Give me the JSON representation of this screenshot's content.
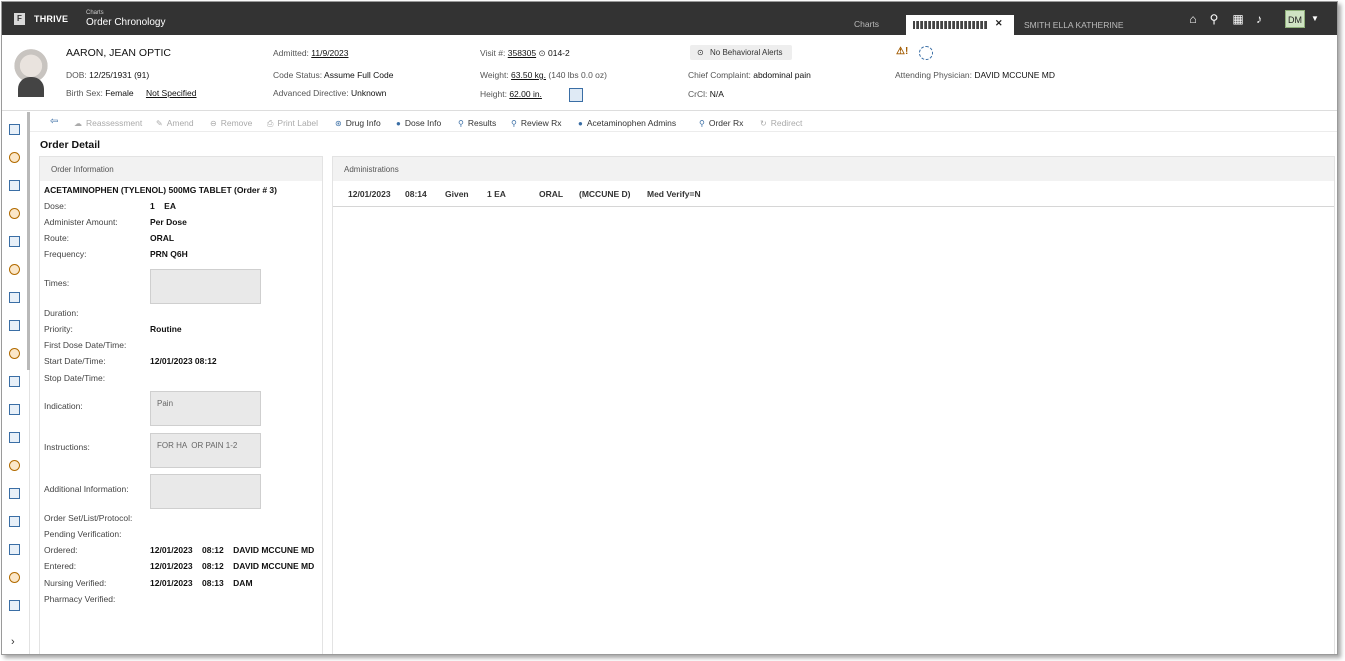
{
  "app": {
    "name": "THRIVE",
    "logo_letter": "F",
    "breadcrumb_parent": "Charts",
    "page_title": "Order Chronology"
  },
  "topnav": {
    "charts_label": "Charts",
    "active_tab_close": "✕",
    "patient_tab": "SMITH ELLA KATHERINE",
    "icons": [
      "home-icon",
      "search-icon",
      "apps-grid-icon",
      "bell-icon"
    ],
    "user_initials": "DM"
  },
  "patient": {
    "name": "AARON, JEAN OPTIC",
    "dob_label": "DOB:",
    "dob": "12/25/1931",
    "age": "(91)",
    "birth_sex_label": "Birth Sex:",
    "birth_sex": "Female",
    "gender": "Not Specified",
    "admitted_label": "Admitted:",
    "admitted": "11/9/2023",
    "code_status_label": "Code Status:",
    "code_status": "Assume Full Code",
    "adv_directive_label": "Advanced Directive:",
    "adv_directive": "Unknown",
    "visit_label": "Visit #:",
    "visit": "358305",
    "room": "014-2",
    "weight_label": "Weight:",
    "weight": "63.50 kg.",
    "weight_alt": "(140 lbs 0.0 oz)",
    "height_label": "Height:",
    "height": "62.00 in.",
    "behavioral_alerts": "No Behavioral Alerts",
    "chief_complaint_label": "Chief Complaint:",
    "chief_complaint": "abdominal pain",
    "crcl_label": "CrCl:",
    "crcl": "N/A",
    "attending_label": "Attending Physician:",
    "attending": "DAVID MCCUNE MD"
  },
  "toolbar": {
    "items": [
      {
        "label": "Reassessment",
        "icon": "reassessment-icon",
        "enabled": false
      },
      {
        "label": "Amend",
        "icon": "pencil-icon",
        "enabled": false
      },
      {
        "label": "Remove",
        "icon": "remove-icon",
        "enabled": false
      },
      {
        "label": "Print Label",
        "icon": "printer-icon",
        "enabled": false
      },
      {
        "label": "Drug Info",
        "icon": "drug-info-icon",
        "enabled": true
      },
      {
        "label": "Dose Info",
        "icon": "info-icon",
        "enabled": true
      },
      {
        "label": "Results",
        "icon": "magnifier-icon",
        "enabled": true
      },
      {
        "label": "Review Rx",
        "icon": "magnifier-icon",
        "enabled": true
      },
      {
        "label": "Acetaminophen Admins",
        "icon": "pill-icon",
        "enabled": true
      },
      {
        "label": "Order Rx",
        "icon": "magnifier-icon",
        "enabled": true
      },
      {
        "label": "Redirect",
        "icon": "redirect-icon",
        "enabled": false
      }
    ]
  },
  "section_title": "Order Detail",
  "order_info": {
    "header": "Order Information",
    "order_name": "ACETAMINOPHEN (TYLENOL) 500MG TABLET (Order # 3)",
    "dose_label": "Dose:",
    "dose": "1    EA",
    "admin_amount_label": "Administer Amount:",
    "admin_amount": "Per Dose",
    "route_label": "Route:",
    "route": "ORAL",
    "frequency_label": "Frequency:",
    "frequency": "PRN Q6H",
    "times_label": "Times:",
    "times": "",
    "duration_label": "Duration:",
    "priority_label": "Priority:",
    "priority": "Routine",
    "first_dose_label": "First Dose Date/Time:",
    "start_label": "Start Date/Time:",
    "start": "12/01/2023 08:12",
    "stop_label": "Stop Date/Time:",
    "indication_label": "Indication:",
    "indication": "Pain",
    "instructions_label": "Instructions:",
    "instructions": "FOR HA  OR PAIN 1-2",
    "additional_label": "Additional Information:",
    "additional": "",
    "order_set_label": "Order Set/List/Protocol:",
    "pending_label": "Pending Verification:",
    "ordered_label": "Ordered:",
    "ordered": "12/01/2023    08:12    DAVID MCCUNE MD",
    "entered_label": "Entered:",
    "entered": "12/01/2023    08:12    DAVID MCCUNE MD",
    "nursing_label": "Nursing Verified:",
    "nursing": "12/01/2023    08:13    DAM",
    "pharmacy_label": "Pharmacy Verified:"
  },
  "administrations": {
    "header": "Administrations",
    "rows": [
      {
        "date": "12/01/2023",
        "time": "08:14",
        "status": "Given",
        "amount": "1 EA",
        "route": "ORAL",
        "by": "(MCCUNE D)",
        "verify": "Med Verify=N"
      }
    ]
  }
}
